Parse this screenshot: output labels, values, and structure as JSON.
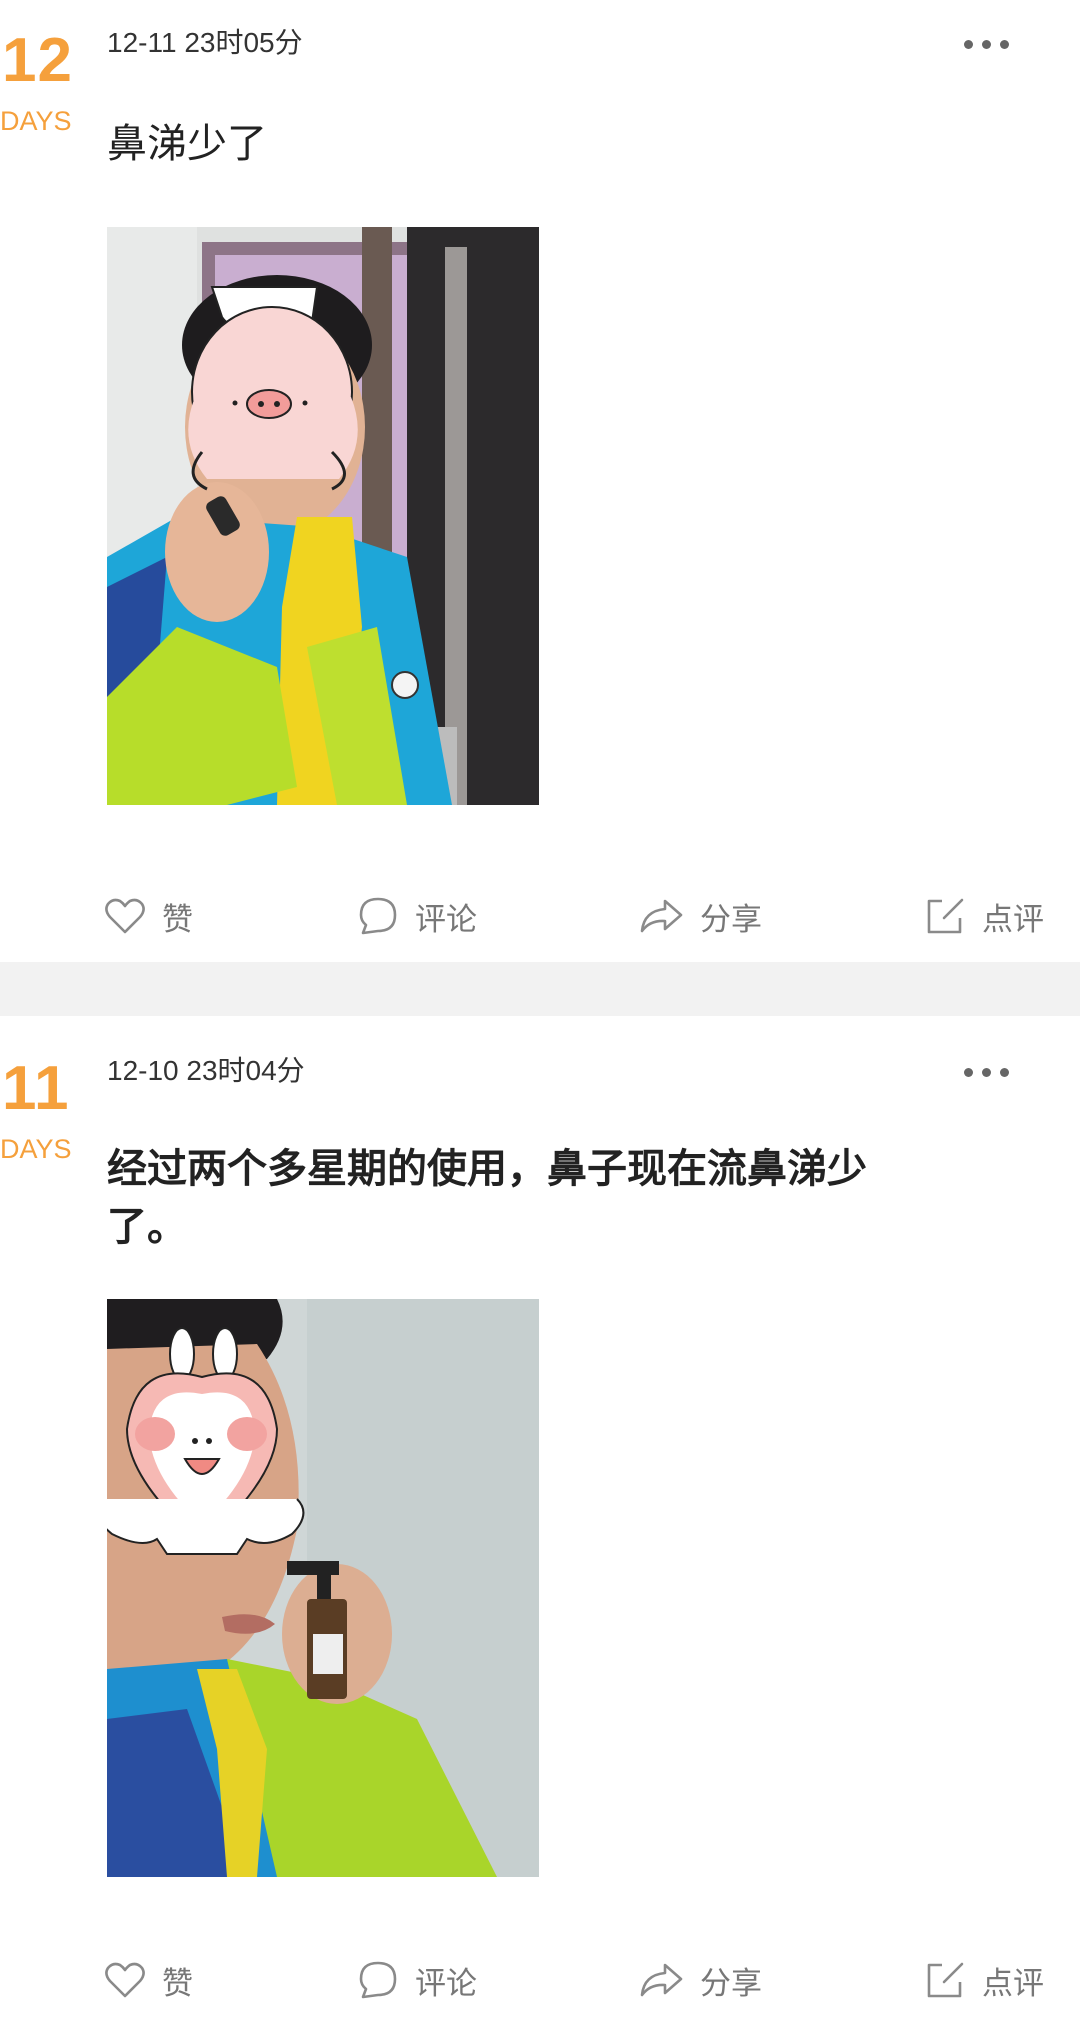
{
  "theme": {
    "accent": "#f5a03c",
    "icon_color": "#8a8a8a",
    "separator": "#f2f2f2"
  },
  "posts": [
    {
      "day_number": "12",
      "day_unit": "DAYS",
      "timestamp": "12-11 23时05分",
      "more_icon": "more-dots-icon",
      "text": "鼻涕少了",
      "photo_subject": "boy in blue and lime jacket applying nasal spray, face covered by pig sticker",
      "actions": {
        "like": "赞",
        "comment": "评论",
        "share": "分享",
        "review": "点评"
      }
    },
    {
      "day_number": "11",
      "day_unit": "DAYS",
      "timestamp": "12-10 23时04分",
      "more_icon": "more-dots-icon",
      "text_line1": "经过两个多星期的使用，鼻子现在流鼻涕少",
      "text_line2": "了。",
      "photo_subject": "boy holding nasal spray bottle, face covered by bunny sticker",
      "actions": {
        "like": "赞",
        "comment": "评论",
        "share": "分享",
        "review": "点评"
      }
    }
  ]
}
